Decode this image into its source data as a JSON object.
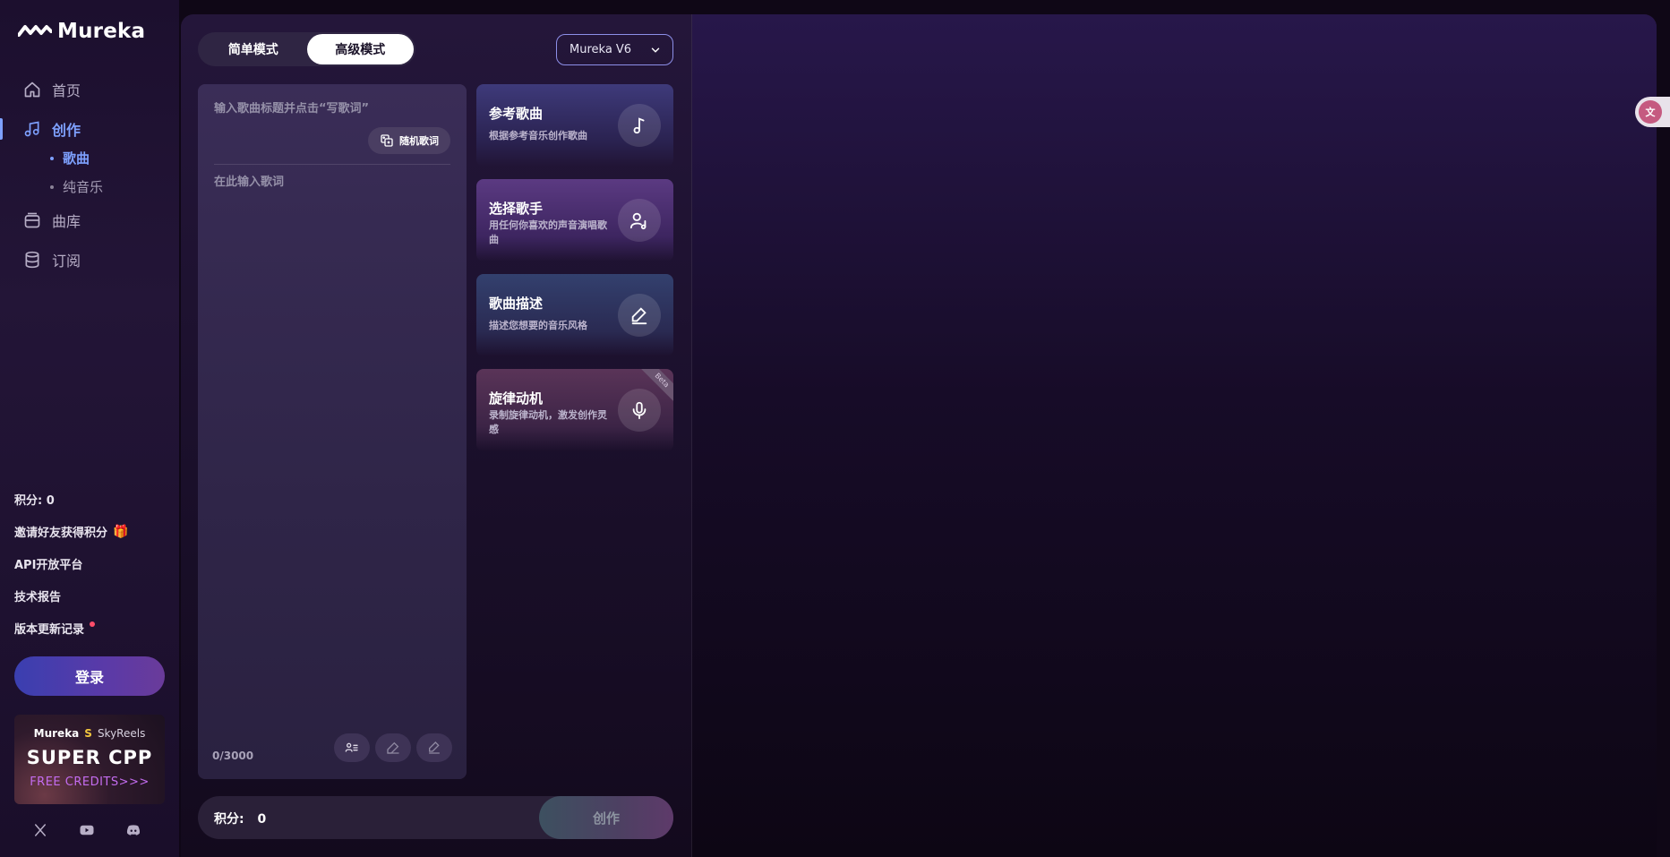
{
  "app": {
    "name": "Mureka"
  },
  "sidebar": {
    "nav": [
      {
        "label": "首页",
        "icon": "home-icon"
      },
      {
        "label": "创作",
        "icon": "music-note-icon",
        "active": true
      },
      {
        "label": "曲库",
        "icon": "library-icon"
      },
      {
        "label": "订阅",
        "icon": "database-icon"
      }
    ],
    "sub_items": [
      {
        "label": "歌曲",
        "active": true
      },
      {
        "label": "纯音乐"
      }
    ],
    "credits": "积分: 0",
    "invite": "邀请好友获得积分",
    "api": "API开放平台",
    "tech_report": "技术报告",
    "changelog": "版本更新记录",
    "login": "登录",
    "promo": {
      "brand1": "Mureka",
      "brand2": "SkyReels",
      "headline": "SUPER CPP",
      "sub": "FREE CREDITS>>>"
    },
    "socials": [
      "x-icon",
      "youtube-icon",
      "discord-icon"
    ]
  },
  "toolbar": {
    "mode_simple": "简单模式",
    "mode_advanced": "高级模式",
    "model": "Mureka V6"
  },
  "lyrics": {
    "title_placeholder": "输入歌曲标题并点击“写歌词”",
    "random_label": "随机歌词",
    "lyrics_placeholder": "在此输入歌词",
    "char_count": "0/3000"
  },
  "features": [
    {
      "title": "参考歌曲",
      "desc": "根据参考音乐创作歌曲",
      "icon": "music-note-icon"
    },
    {
      "title": "选择歌手",
      "desc": "用任何你喜欢的声音演唱歌曲",
      "icon": "singer-icon"
    },
    {
      "title": "歌曲描述",
      "desc": "描述您想要的音乐风格",
      "icon": "edit-icon"
    },
    {
      "title": "旋律动机",
      "desc": "录制旋律动机，激发创作灵感",
      "icon": "microphone-icon",
      "badge": "Beta"
    }
  ],
  "bottom": {
    "credits_label": "积分:",
    "credits_value": "0",
    "create": "创作"
  },
  "colors": {
    "accent": "#7ea1ff",
    "background": "#0f0716",
    "panel": "#2f2548"
  }
}
